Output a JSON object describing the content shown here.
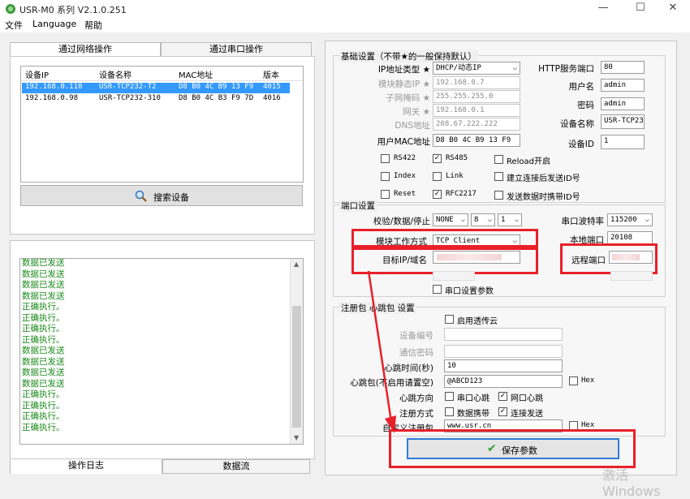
{
  "window": {
    "title": "USR-M0 系列 V2.1.0.251",
    "minimize": "—",
    "maximize": "☐",
    "close": "✕"
  },
  "menu": [
    "文件",
    "Language",
    "帮助"
  ],
  "left": {
    "tabs": [
      "通过网络操作",
      "通过串口操作"
    ],
    "table": {
      "headers": [
        "设备IP",
        "设备名称",
        "MAC地址",
        "版本"
      ],
      "rows": [
        {
          "ip": "192.168.0.110",
          "name": "USR-TCP232-T2",
          "mac": "D8 B0 4C B9 13 F9",
          "ver": "4015"
        },
        {
          "ip": "192.168.0.98",
          "name": "USR-TCP232-310",
          "mac": "D8 B0 4C B3 F9 7D",
          "ver": "4016"
        }
      ]
    },
    "search_label": "搜索设备",
    "log_lines": [
      "数据已发送",
      "数据已发送",
      "数据已发送",
      "数据已发送",
      " 正确执行。",
      " 正确执行。",
      " 正确执行。",
      " 正确执行。",
      "数据已发送",
      "数据已发送",
      "数据已发送",
      "数据已发送",
      " 正确执行。",
      " 正确执行。",
      " 正确执行。",
      " 正确执行。"
    ],
    "bottom_tabs": [
      "操作日志",
      "数据流"
    ]
  },
  "basic": {
    "title": "基础设置（不带★的一般保持默认）",
    "ip_type_label": "IP地址类型 ★",
    "ip_type": "DHCP/动态IP",
    "static_ip_label": "模块静态IP ★",
    "static_ip": "192.168.0.7",
    "mask_label": "子网掩码 ★",
    "mask": "255.255.255.0",
    "gw_label": "网关 ★",
    "gw": "192.168.0.1",
    "dns_label": "DNS地址",
    "dns": "208.67.222.222",
    "mac_label": "用户MAC地址",
    "mac": "D8 B0 4C B9 13 F9",
    "http_label": "HTTP服务端口",
    "http": "80",
    "user_label": "用户名",
    "user": "admin",
    "pwd_label": "密码",
    "pwd": "admin",
    "devname_label": "设备名称",
    "devname": "USR-TCP23",
    "devid_label": "设备ID",
    "devid": "1",
    "checks": [
      {
        "label": "RS422",
        "checked": false
      },
      {
        "label": "RS485",
        "checked": true
      },
      {
        "label": "Reload开启",
        "checked": false
      },
      {
        "label": "Index",
        "checked": false
      },
      {
        "label": "Link",
        "checked": false
      },
      {
        "label": "建立连接后发送ID号",
        "checked": false
      },
      {
        "label": "Reset",
        "checked": false
      },
      {
        "label": "RFC2217",
        "checked": true
      },
      {
        "label": "发送数据时携带ID号",
        "checked": false
      }
    ]
  },
  "port": {
    "title": "端口设置",
    "parity_label": "校验/数据/停止",
    "parity": "NONE",
    "databits": "8",
    "stopbits": "1",
    "baud_label": "串口波特率",
    "baud": "115200",
    "mode_label": "模块工作方式",
    "mode": "TCP Client",
    "local_port_label": "本地端口",
    "local_port": "20108",
    "target_label": "目标IP/域名",
    "remote_port_label": "远程端口",
    "serial_params_label": "串口设置参数"
  },
  "reg": {
    "title": "注册包 心跳包 设置",
    "cloud_label": "启用透传云",
    "devno_label": "设备编号",
    "commpwd_label": "通信密码",
    "hb_time_label": "心跳时间(秒)",
    "hb_time": "10",
    "hb_pkt_label": "心跳包(不启用请置空)",
    "hb_pkt": "@ABCD123",
    "hex_label": "Hex",
    "hb_dir_label": "心跳方向",
    "hb_serial": "串口心跳",
    "hb_net": "网口心跳",
    "reg_mode_label": "注册方式",
    "reg_carry": "数据携带",
    "reg_conn": "连接发送",
    "custom_label": "自定义注册包",
    "custom": "www.usr.cn"
  },
  "save_label": "保存参数",
  "watermark": "激活 Windows"
}
